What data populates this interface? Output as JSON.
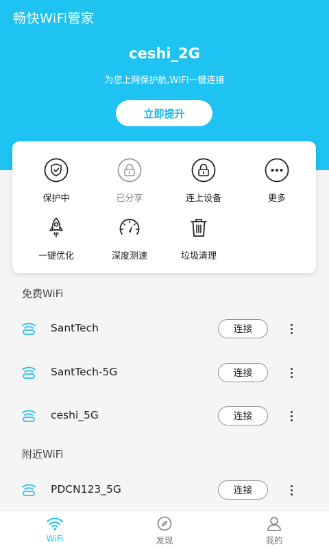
{
  "header": {
    "app_title": "畅快WiFi管家",
    "ssid": "ceshi_2G",
    "subtitle": "为您上网保护航,WIFI一键连接",
    "boost_label": "立即提升"
  },
  "tools": [
    {
      "label": "保护中",
      "icon": "shield-check-icon"
    },
    {
      "label": "已分享",
      "icon": "lock-share-icon"
    },
    {
      "label": "连上设备",
      "icon": "lock-device-icon"
    },
    {
      "label": "更多",
      "icon": "more-icon"
    },
    {
      "label": "一键优化",
      "icon": "rocket-icon"
    },
    {
      "label": "深度测速",
      "icon": "speedometer-icon"
    },
    {
      "label": "垃圾清理",
      "icon": "trash-icon"
    }
  ],
  "free_section": {
    "title": "免费WiFi",
    "networks": [
      {
        "name": "SantTech",
        "action": "连接"
      },
      {
        "name": "SantTech-5G",
        "action": "连接"
      },
      {
        "name": "ceshi_5G",
        "action": "连接"
      }
    ]
  },
  "nearby_section": {
    "title": "附近WiFi",
    "networks": [
      {
        "name": "PDCN123_5G",
        "action": "连接"
      }
    ]
  },
  "tabbar": {
    "items": [
      {
        "label": "WiFi",
        "icon": "wifi-icon",
        "active": true
      },
      {
        "label": "发现",
        "icon": "compass-icon",
        "active": false
      },
      {
        "label": "我的",
        "icon": "user-icon",
        "active": false
      }
    ]
  },
  "colors": {
    "accent": "#1ec3f2",
    "header_bg": "#1ec3f2",
    "page_bg": "#f5f5f5"
  }
}
